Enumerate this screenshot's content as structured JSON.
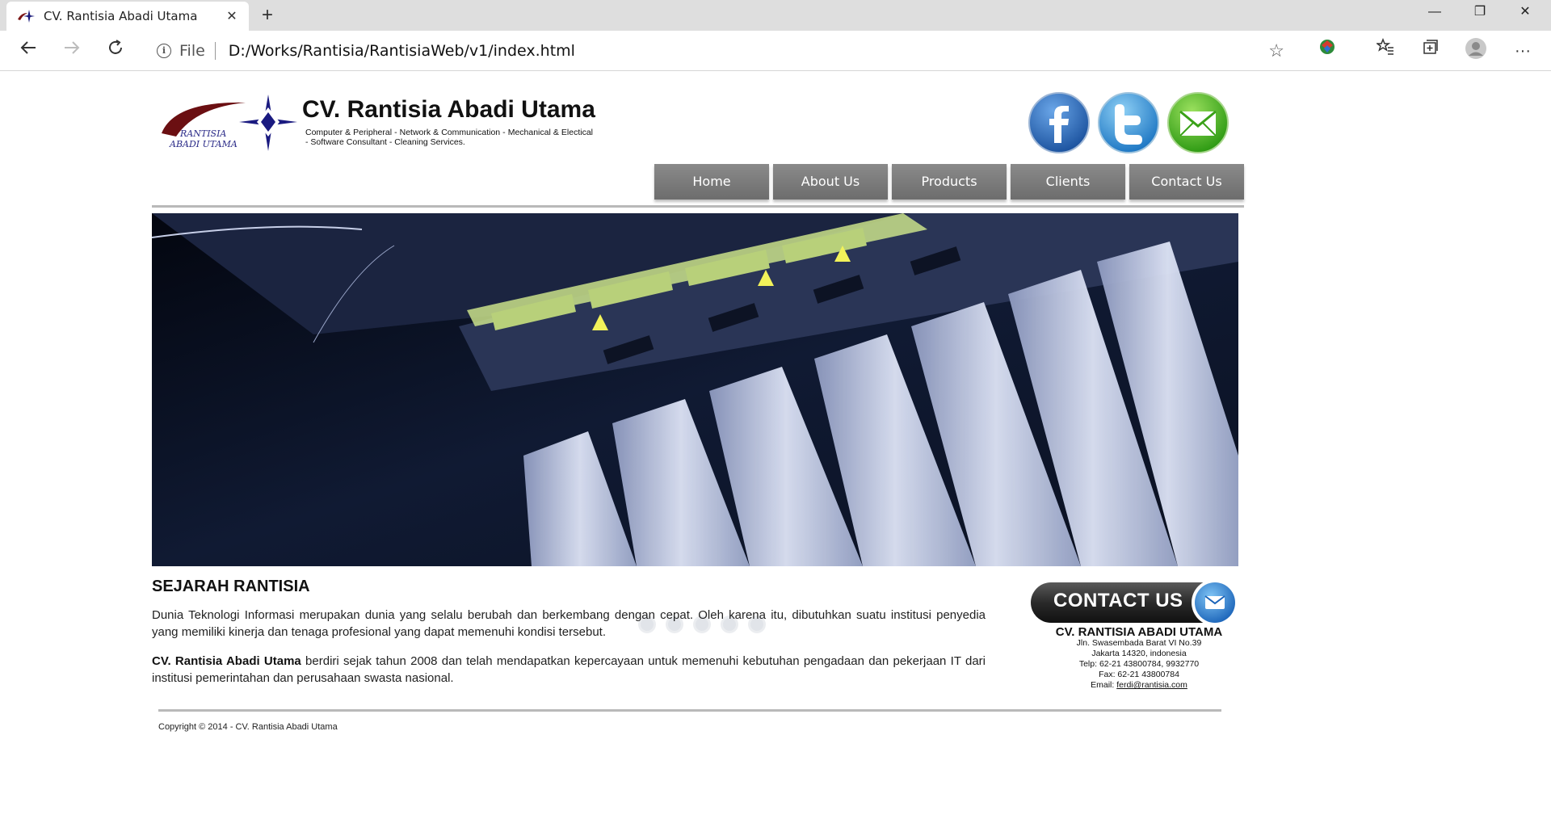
{
  "browser": {
    "tab_title": "CV. Rantisia Abadi Utama",
    "tab_close": "✕",
    "new_tab": "+",
    "scheme": "File",
    "url": "D:/Works/Rantisia/RantisiaWeb/v1/index.html",
    "window": {
      "minimize": "—",
      "restore": "❐",
      "close": "✕"
    },
    "icons": [
      "back-icon",
      "forward-icon",
      "refresh-icon",
      "info-icon",
      "star-icon",
      "extension-icon",
      "favorites-icon",
      "collections-icon",
      "profile-icon",
      "more-icon"
    ]
  },
  "site": {
    "logo_text_1": "RANTISIA",
    "logo_text_2": "ABADI UTAMA",
    "title": "CV. Rantisia Abadi Utama",
    "tagline": "Computer & Peripheral - Network & Communication - Mechanical & Electical - Software Consultant - Cleaning Services.",
    "social": [
      "facebook-icon",
      "twitter-icon",
      "email-icon"
    ],
    "colors": {
      "facebook": "#2a6bb8",
      "twitter": "#2f8fd4",
      "email": "#4ab521",
      "menu": "#7a7a7a"
    }
  },
  "menu": [
    "Home",
    "About Us",
    "Products",
    "Clients",
    "Contact Us"
  ],
  "content": {
    "heading": "SEJARAH RANTISIA",
    "para1": "Dunia Teknologi Informasi merupakan dunia yang selalu berubah dan berkembang dengan cepat. Oleh karena itu, dibutuhkan suatu institusi penyedia yang memiliki kinerja dan tenaga profesional yang dapat memenuhi kondisi tersebut.",
    "para2_bold": "CV. Rantisia Abadi Utama",
    "para2_rest": " berdiri sejak tahun 2008 dan telah mendapatkan kepercayaan untuk memenuhi kebutuhan pengadaan dan pekerjaan IT dari institusi pemerintahan dan perusahaan swasta nasional."
  },
  "contact": {
    "button_label": "CONTACT US",
    "company": "CV. RANTISIA ABADI UTAMA",
    "address1": "Jln. Swasembada Barat VI No.39",
    "address2": "Jakarta 14320, indonesia",
    "phone": "Telp: 62-21 43800784, 9932770",
    "fax": "Fax: 62-21 43800784",
    "email_label": "Email: ",
    "email": "ferdi@rantisia.com"
  },
  "footer": {
    "copyright": "Copyright © 2014 - CV. Rantisia Abadi Utama"
  }
}
